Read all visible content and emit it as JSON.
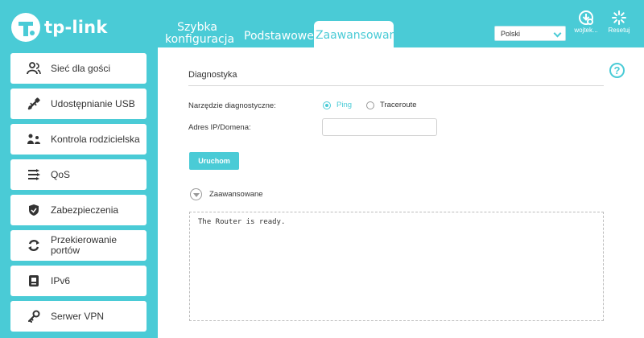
{
  "header": {
    "logo_text": "tp-link",
    "tabs": [
      {
        "label_line1": "Szybka",
        "label_line2": "konfiguracja"
      },
      {
        "label": "Podstawowe"
      },
      {
        "label": "Zaawansowane"
      }
    ],
    "language": "Polski",
    "user_label": "wojtek...",
    "reset_label": "Resetuj"
  },
  "sidebar": {
    "items": [
      {
        "label": "Sieć dla gości",
        "icon": "guests-icon"
      },
      {
        "label": "Udostępnianie USB",
        "icon": "usb-icon"
      },
      {
        "label": "Kontrola rodzicielska",
        "icon": "family-icon"
      },
      {
        "label": "QoS",
        "icon": "qos-icon"
      },
      {
        "label": "Zabezpieczenia",
        "icon": "shield-icon"
      },
      {
        "label_line1": "Przekierowanie",
        "label_line2": "portów",
        "icon": "forwarding-icon"
      },
      {
        "label": "IPv6",
        "icon": "ipv6-icon"
      },
      {
        "label": "Serwer VPN",
        "icon": "vpn-key-icon"
      }
    ]
  },
  "main": {
    "section_title": "Diagnostyka",
    "tool_label": "Narzędzie diagnostyczne:",
    "tool_options": [
      {
        "label": "Ping",
        "selected": true
      },
      {
        "label": "Traceroute",
        "selected": false
      }
    ],
    "address_label": "Adres IP/Domena:",
    "address_value": "",
    "run_label": "Uruchom",
    "advanced_label": "Zaawansowane",
    "output_text": "The Router is ready."
  },
  "colors": {
    "accent": "#4acbd6",
    "text": "#333333"
  }
}
